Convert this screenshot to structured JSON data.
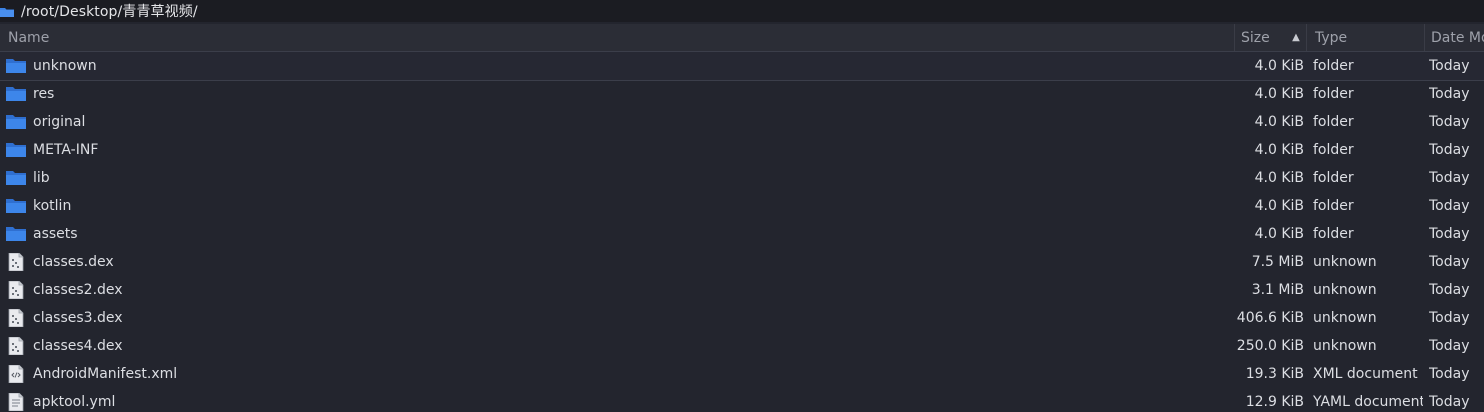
{
  "pathbar": {
    "path": "/root/Desktop/青青草视频/"
  },
  "columns": {
    "name": "Name",
    "size": "Size",
    "sort_indicator": "▲",
    "type": "Type",
    "date": "Date Mo"
  },
  "files": [
    {
      "name": "unknown",
      "size": "4.0 KiB",
      "type": "folder",
      "date": "Today",
      "icon": "folder-icon"
    },
    {
      "name": "res",
      "size": "4.0 KiB",
      "type": "folder",
      "date": "Today",
      "icon": "folder-icon"
    },
    {
      "name": "original",
      "size": "4.0 KiB",
      "type": "folder",
      "date": "Today",
      "icon": "folder-icon"
    },
    {
      "name": "META-INF",
      "size": "4.0 KiB",
      "type": "folder",
      "date": "Today",
      "icon": "folder-icon"
    },
    {
      "name": "lib",
      "size": "4.0 KiB",
      "type": "folder",
      "date": "Today",
      "icon": "folder-icon"
    },
    {
      "name": "kotlin",
      "size": "4.0 KiB",
      "type": "folder",
      "date": "Today",
      "icon": "folder-icon"
    },
    {
      "name": "assets",
      "size": "4.0 KiB",
      "type": "folder",
      "date": "Today",
      "icon": "folder-icon"
    },
    {
      "name": "classes.dex",
      "size": "7.5 MiB",
      "type": "unknown",
      "date": "Today",
      "icon": "binary-file-icon"
    },
    {
      "name": "classes2.dex",
      "size": "3.1 MiB",
      "type": "unknown",
      "date": "Today",
      "icon": "binary-file-icon"
    },
    {
      "name": "classes3.dex",
      "size": "406.6 KiB",
      "type": "unknown",
      "date": "Today",
      "icon": "binary-file-icon"
    },
    {
      "name": "classes4.dex",
      "size": "250.0 KiB",
      "type": "unknown",
      "date": "Today",
      "icon": "binary-file-icon"
    },
    {
      "name": "AndroidManifest.xml",
      "size": "19.3 KiB",
      "type": "XML document",
      "date": "Today",
      "icon": "xml-file-icon"
    },
    {
      "name": "apktool.yml",
      "size": "12.9 KiB",
      "type": "YAML document",
      "date": "Today",
      "icon": "text-file-icon"
    }
  ],
  "colors": {
    "background": "#23252e",
    "header": "#2b2d36",
    "pathbar": "#1b1c22",
    "folder": "#3b82e6",
    "text": "#dcdee3"
  }
}
